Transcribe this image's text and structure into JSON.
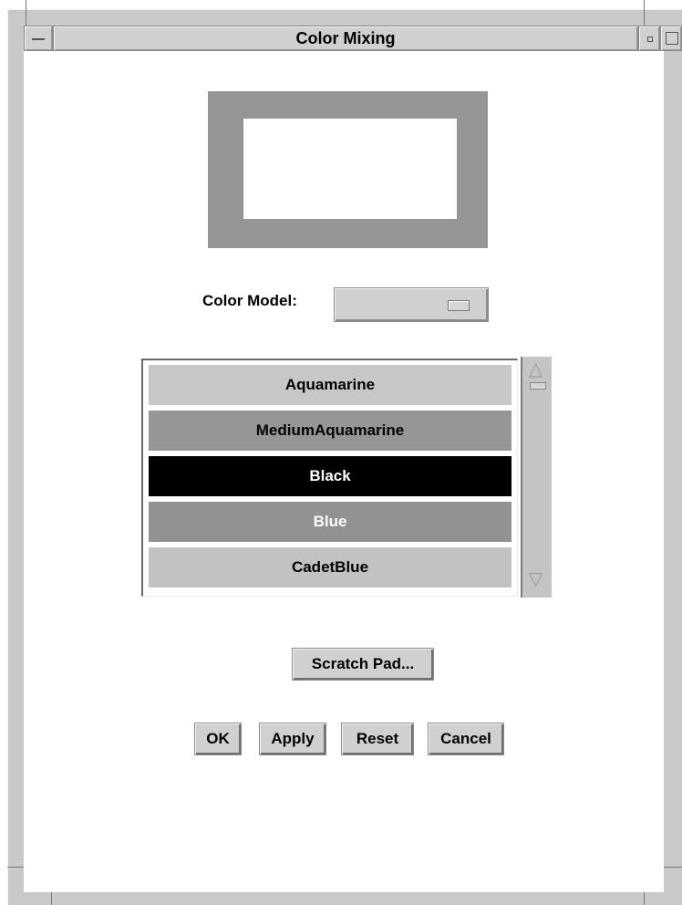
{
  "window": {
    "title": "Color Mixing"
  },
  "preview": {
    "border_color": "#959595",
    "fill_color": "#ffffff"
  },
  "color_model": {
    "label": "Color Model:",
    "value": ""
  },
  "color_list": {
    "items": [
      {
        "label": "Aquamarine",
        "bg": "#c7c7c7",
        "fg": "#000000"
      },
      {
        "label": "MediumAquamarine",
        "bg": "#969696",
        "fg": "#000000"
      },
      {
        "label": "Black",
        "bg": "#000000",
        "fg": "#ffffff"
      },
      {
        "label": "Blue",
        "bg": "#929292",
        "fg": "#ffffff"
      },
      {
        "label": "CadetBlue",
        "bg": "#c2c2c2",
        "fg": "#000000"
      }
    ],
    "selected_index": 2
  },
  "buttons": {
    "scratch_pad": "Scratch Pad...",
    "ok": "OK",
    "apply": "Apply",
    "reset": "Reset",
    "cancel": "Cancel"
  },
  "icons": {
    "window_menu": "window-menu-icon",
    "minimize": "minimize-icon",
    "maximize": "maximize-icon",
    "scroll_up": "scroll-up-arrow-icon",
    "scroll_down": "scroll-down-arrow-icon"
  }
}
